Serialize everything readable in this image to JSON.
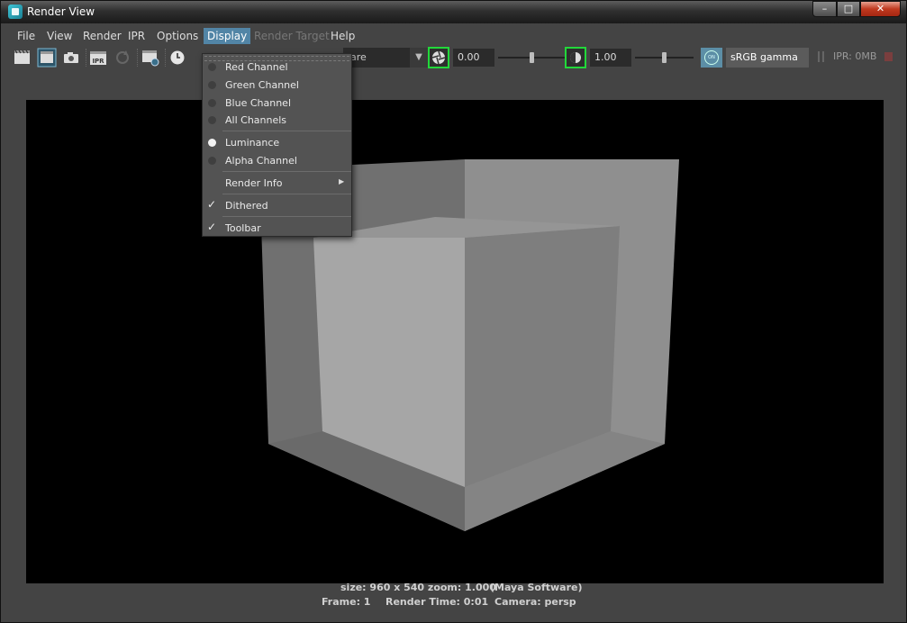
{
  "window": {
    "title": "Render View",
    "minimize": "–",
    "maximize": "□",
    "close": "✕"
  },
  "menubar": {
    "items": [
      {
        "label": "File"
      },
      {
        "label": "View"
      },
      {
        "label": "Render"
      },
      {
        "label": "IPR"
      },
      {
        "label": "Options"
      },
      {
        "label": "Display",
        "state": "open"
      },
      {
        "label": "Render Target",
        "state": "disabled"
      },
      {
        "label": "Help"
      }
    ]
  },
  "toolbar": {
    "icons": [
      "render-frame-icon",
      "render-region-icon",
      "snapshot-icon",
      "ipr-render-icon",
      "refresh-ipr-icon",
      "render-sequence-icon",
      "clock-icon"
    ],
    "preset_text": "are",
    "exposure": "0.00",
    "gamma": "1.00",
    "exposure_level": 0.5,
    "gamma_level": 0.5,
    "color_manage_badge": "ON",
    "colorspace": "sRGB gamma",
    "ipr_memory": "IPR: 0MB"
  },
  "display_menu": {
    "items": [
      {
        "label": "Red Channel",
        "type": "radio",
        "checked": false
      },
      {
        "label": "Green Channel",
        "type": "radio",
        "checked": false
      },
      {
        "label": "Blue Channel",
        "type": "radio",
        "checked": false
      },
      {
        "label": "All Channels",
        "type": "radio",
        "checked": false
      },
      {
        "label": "Luminance",
        "type": "radio",
        "checked": true
      },
      {
        "label": "Alpha Channel",
        "type": "radio",
        "checked": false
      },
      {
        "label": "Render Info",
        "type": "submenu"
      },
      {
        "label": "Dithered",
        "type": "check",
        "checked": true
      },
      {
        "label": "Toolbar",
        "type": "check",
        "checked": true
      }
    ]
  },
  "status": {
    "size_zoom": "size: 960 x 540 zoom: 1.000",
    "renderer": "(Maya Software)",
    "frame": "Frame: 1",
    "render_time": "Render Time: 0:01",
    "camera": "Camera: persp"
  },
  "colors": {
    "accent": "#5285a6",
    "panel": "#444444",
    "viewport_bg": "#000000",
    "bracket": "#22d83a"
  }
}
